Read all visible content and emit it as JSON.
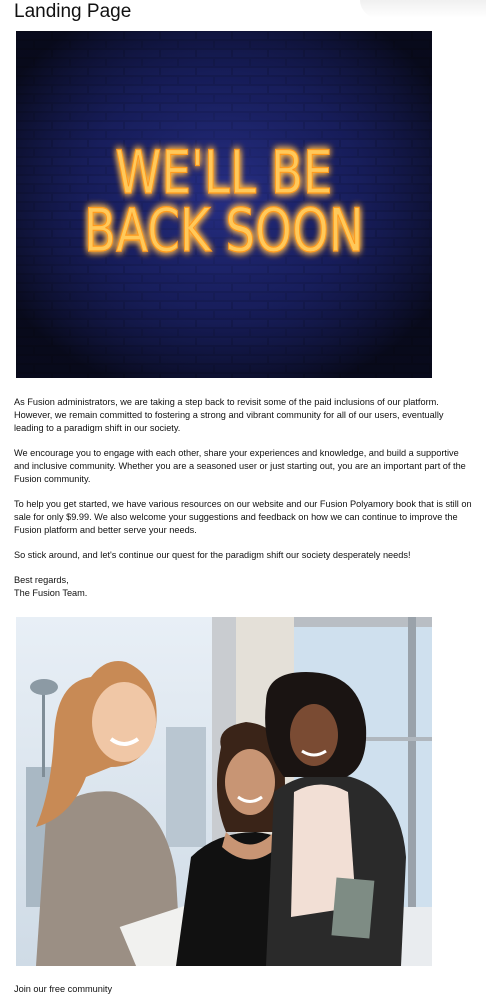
{
  "page": {
    "title": "Landing Page"
  },
  "hero": {
    "line1": "WE'LL BE",
    "line2": "BACK SOON"
  },
  "message": {
    "paragraphs": [
      "As Fusion administrators, we are taking a step back to revisit some of the paid inclusions of our platform. However, we remain committed to fostering a strong and vibrant community for all of our users, eventually leading to a paradigm shift in our society.",
      "We encourage you to engage with each other, share your experiences and knowledge, and build a supportive and inclusive community. Whether you are a seasoned user or just starting out, you are an important part of the Fusion community.",
      "To help you get started, we have various resources on our website and our Fusion Polyamory book that is still on sale for only $9.99. We also welcome your suggestions and feedback on how we can continue to improve the Fusion platform and better serve your needs.",
      "So stick around, and let's continue our quest for the paradigm shift our society desperately needs!"
    ],
    "signoff": "Best regards,",
    "signature": "The Fusion Team."
  },
  "footer": {
    "join_text": "Join our free community"
  },
  "colors": {
    "neon": "#ffb43a",
    "brick_dark": "#0a0c1e",
    "brick_light": "#2a2f7a"
  }
}
